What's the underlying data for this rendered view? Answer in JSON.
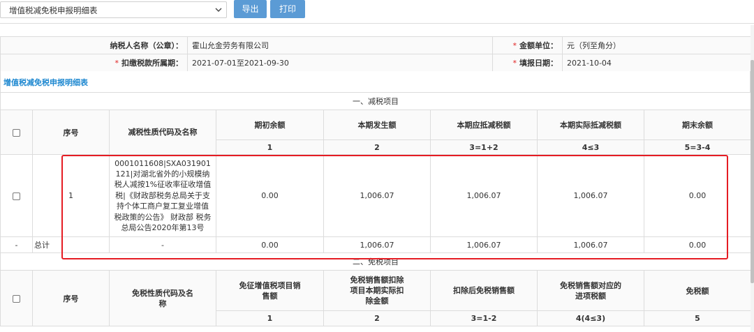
{
  "toolbar": {
    "report_select": "增值税减免税申报明细表",
    "export_label": "导出",
    "print_label": "打印"
  },
  "info": {
    "taxpayer_label": "纳税人名称（公章）：",
    "taxpayer_value": "霍山允金劳务有限公司",
    "unit_label": "金额单位：",
    "unit_value": "元（列至角分）",
    "period_label": "扣缴税款所属期：",
    "period_value": "2021-07-01至2021-09-30",
    "fill_date_label": "填报日期：",
    "fill_date_value": "2021-10-04",
    "required_mark": "*"
  },
  "section_title": "增值税减免税申报明细表",
  "reduction": {
    "heading": "一、减税项目",
    "col_seq": "序号",
    "col_code": "减税性质代码及名称",
    "col_opening": "期初余额",
    "col_current": "本期发生额",
    "col_due": "本期应抵减税额",
    "col_actual": "本期实际抵减税额",
    "col_closing": "期末余额",
    "num_opening": "1",
    "num_current": "2",
    "num_due": "3=1+2",
    "num_actual": "4≤3",
    "num_closing": "5=3-4",
    "row": {
      "seq": "1",
      "desc": "0001011608|SXA031901121|对湖北省外的小规模纳税人减按1%征收率征收增值税|《财政部税务总局关于支持个体工商户复工复业增值税政策的公告》 财政部 税务总局公告2020年第13号",
      "opening": "0.00",
      "current": "1,006.07",
      "due": "1,006.07",
      "actual": "1,006.07",
      "closing": "0.00"
    },
    "total": {
      "dash": "-",
      "label": "总计",
      "code": "-",
      "opening": "0.00",
      "current": "1,006.07",
      "due": "1,006.07",
      "actual": "1,006.07",
      "closing": "0.00"
    }
  },
  "exemption": {
    "heading": "二、免税项目",
    "col_seq": "序号",
    "col_code": "免税性质代码及名称",
    "col_sales": "免征增值税项目销售额",
    "col_deduct": "免税销售额扣除项目本期实际扣除金额",
    "col_after": "扣除后免税销售额",
    "col_input": "免税销售额对应的进项税额",
    "col_exempt": "免税额",
    "num_sales": "1",
    "num_deduct": "2",
    "num_after": "3=1-2",
    "num_input": "4(4≤3)",
    "num_exempt": "5"
  }
}
